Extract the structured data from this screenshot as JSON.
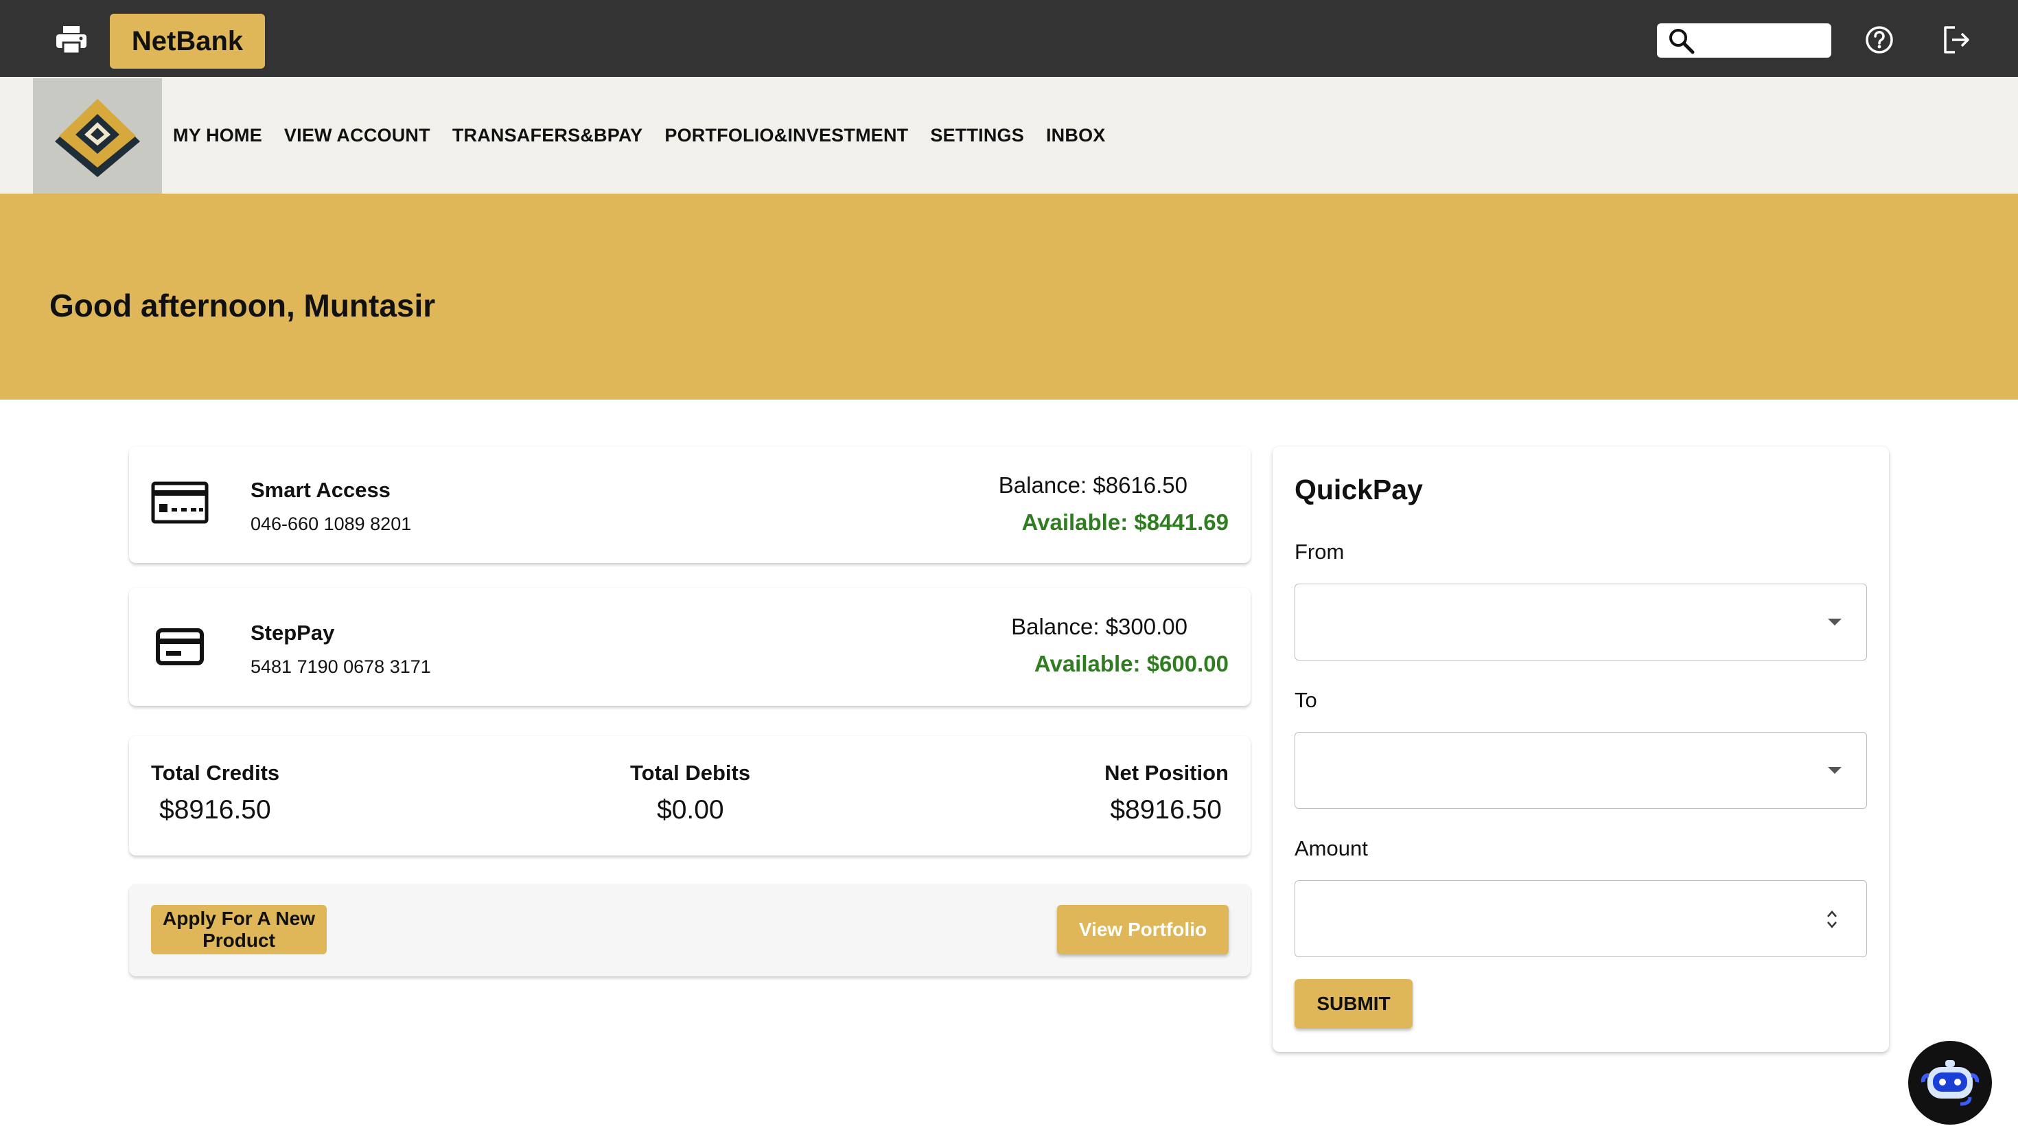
{
  "header": {
    "brand": "NetBank",
    "search_placeholder": ""
  },
  "nav": {
    "items": [
      {
        "label": "MY HOME"
      },
      {
        "label": "VIEW ACCOUNT"
      },
      {
        "label": "TRANSAFERS&BPAY"
      },
      {
        "label": "PORTFOLIO&INVESTMENT"
      },
      {
        "label": "SETTINGS"
      },
      {
        "label": "INBOX"
      }
    ]
  },
  "banner": {
    "greeting": "Good afternoon, Muntasir"
  },
  "accounts": [
    {
      "name": "Smart Access",
      "number": "046-660 1089 8201",
      "balance": "Balance: $8616.50",
      "available": "Available: $8441.69",
      "icon": "card-icon"
    },
    {
      "name": "StepPay",
      "number": "5481 7190 0678 3171",
      "balance": "Balance: $300.00",
      "available": "Available: $600.00",
      "icon": "credit-card-icon"
    }
  ],
  "totals": {
    "credits_label": "Total Credits",
    "credits_value": "$8916.50",
    "debits_label": "Total Debits",
    "debits_value": "$0.00",
    "net_label": "Net Position",
    "net_value": "$8916.50"
  },
  "actions": {
    "apply_label": "Apply For A New Product",
    "portfolio_label": "View Portfolio"
  },
  "quickpay": {
    "title": "QuickPay",
    "from_label": "From",
    "from_value": "",
    "to_label": "To",
    "to_value": "",
    "amount_label": "Amount",
    "amount_value": "",
    "submit_label": "SUBMIT"
  },
  "colors": {
    "topbar": "#333333",
    "gold": "#dfb758",
    "navbar": "#f1f0ea",
    "available_green": "#2e7d1f"
  }
}
